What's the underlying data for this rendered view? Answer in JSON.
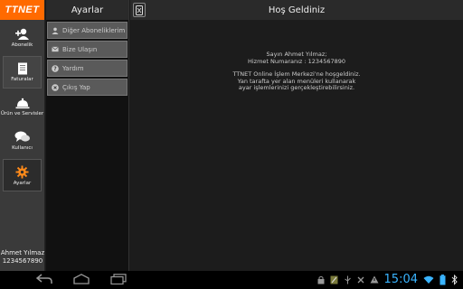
{
  "brand": {
    "logo_text": "TTNET",
    "color": "#ff6a00"
  },
  "rail": {
    "items": [
      {
        "label": "Abonelik",
        "icon": "add-user-icon"
      },
      {
        "label": "Faturalar",
        "icon": "invoice-icon"
      },
      {
        "label": "Ürün ve Servisler",
        "icon": "service-bell-icon"
      },
      {
        "label": "Kullanıcı",
        "icon": "chat-bubbles-icon"
      },
      {
        "label": "Ayarlar",
        "icon": "gear-icon",
        "color": "#ff8a1a"
      }
    ],
    "user_name": "Ahmet Yılmaz",
    "user_number": "1234567890"
  },
  "settings": {
    "title": "Ayarlar",
    "items": [
      {
        "label": "Diğer Aboneliklerim",
        "icon": "person-icon"
      },
      {
        "label": "Bize Ulaşın",
        "icon": "envelope-icon"
      },
      {
        "label": "Yardım",
        "icon": "help-icon"
      },
      {
        "label": "Çıkış Yap",
        "icon": "exit-icon"
      }
    ]
  },
  "main": {
    "title": "Hoş Geldiniz",
    "greeting": "Sayın Ahmet Yılmaz;",
    "service_number": "Hizmet Numaranız : 1234567890",
    "message_line1": "TTNET Online İşlem Merkezi'ne hoşgeldiniz.",
    "message_line2": "Yan tarafta yer alan menüleri kullanarak",
    "message_line3": "ayar işlemlerinizi gerçekleştirebilirsiniz."
  },
  "system_bar": {
    "clock": "15:04",
    "clock_color": "#3ab4ff"
  }
}
